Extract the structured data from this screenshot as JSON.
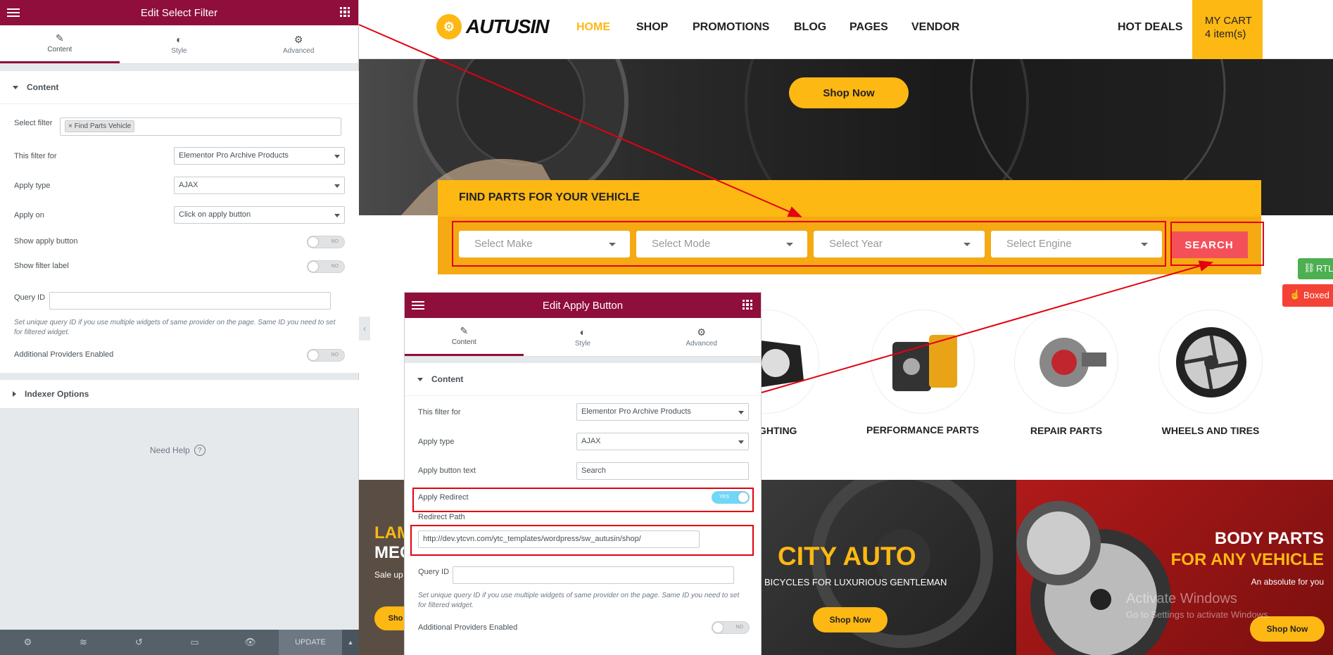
{
  "left_panel": {
    "title": "Edit Select Filter",
    "tabs": [
      "Content",
      "Style",
      "Advanced"
    ],
    "section_content": "Content",
    "fields": {
      "select_filter_label": "Select filter",
      "select_filter_value": "Find Parts Vehicle",
      "filter_for_label": "This filter for",
      "filter_for_value": "Elementor Pro Archive Products",
      "apply_type_label": "Apply type",
      "apply_type_value": "AJAX",
      "apply_on_label": "Apply on",
      "apply_on_value": "Click on apply button",
      "show_apply_button_label": "Show apply button",
      "show_filter_label_label": "Show filter label",
      "query_id_label": "Query ID",
      "query_id_desc": "Set unique query ID if you use multiple widgets of same provider on the page. Same ID you need to set for filtered widget.",
      "additional_providers_label": "Additional Providers Enabled",
      "toggle_off_text": "NO",
      "toggle_on_text": "YES"
    },
    "section_indexer": "Indexer Options",
    "need_help": "Need Help",
    "update_label": "UPDATE"
  },
  "site": {
    "logo": "AUTUSIN",
    "nav": [
      "HOME",
      "SHOP",
      "PROMOTIONS",
      "BLOG",
      "PAGES",
      "VENDOR"
    ],
    "hot_deals": "HOT DEALS",
    "cart_title": "MY CART",
    "cart_items": "4 item(s)",
    "hero_button": "Shop Now",
    "find_parts_title": "FIND PARTS FOR YOUR VEHICLE",
    "dropdowns": [
      "Select Make",
      "Select Mode",
      "Select Year",
      "Select Engine"
    ],
    "search_button": "SEARCH",
    "categories": [
      "GHTING",
      "PERFORMANCE PARTS",
      "REPAIR PARTS",
      "WHEELS AND TIRES"
    ],
    "banners": {
      "left_title_1": "LAM",
      "left_title_2": "MEC",
      "left_sub": "Sale up",
      "left_btn": "Sho",
      "center_title": "CITY AUTO",
      "center_sub": "BICYCLES FOR LUXURIOUS GENTLEMAN",
      "center_btn": "Shop Now",
      "right_title_1": "BODY PARTS",
      "right_title_2": "FOR ANY VEHICLE",
      "right_sub": "An absolute for you",
      "right_btn": "Shop Now"
    },
    "rtl_label": "RTL",
    "boxed_label": "Boxed",
    "watermark_1": "Activate Windows",
    "watermark_2": "Go to Settings to activate Windows."
  },
  "panel2": {
    "title": "Edit Apply Button",
    "tabs": [
      "Content",
      "Style",
      "Advanced"
    ],
    "section_content": "Content",
    "filter_for_label": "This filter for",
    "filter_for_value": "Elementor Pro Archive Products",
    "apply_type_label": "Apply type",
    "apply_type_value": "AJAX",
    "apply_button_text_label": "Apply button text",
    "apply_button_text_value": "Search",
    "apply_redirect_label": "Apply Redirect",
    "redirect_path_label": "Redirect Path",
    "redirect_path_value": "http://dev.ytcvn.com/ytc_templates/wordpress/sw_autusin/shop/",
    "query_id_label": "Query ID",
    "query_id_desc": "Set unique query ID if you use multiple widgets of same provider on the page. Same ID you need to set for filtered widget.",
    "additional_providers_label": "Additional Providers Enabled",
    "toggle_off_text": "NO",
    "toggle_on_text": "YES"
  },
  "colors": {
    "elementor_header": "#8f0e3b",
    "brand_yellow": "#fdb813",
    "search_red": "#f4505a",
    "annotation_red": "#e3000f"
  }
}
